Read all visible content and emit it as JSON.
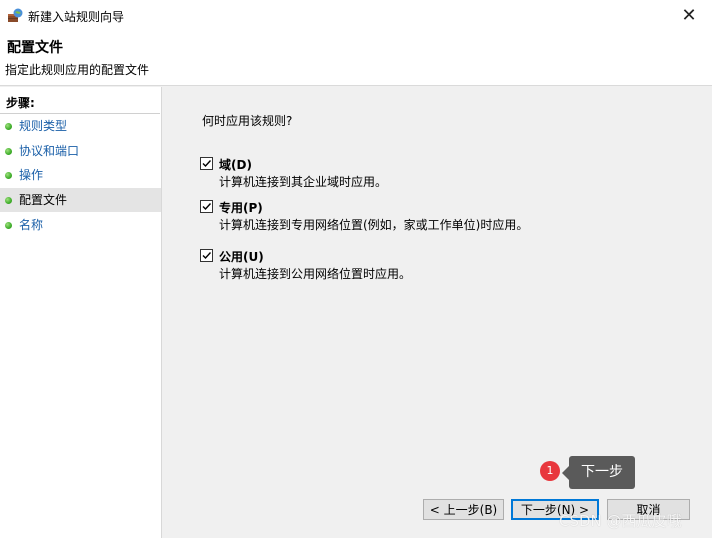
{
  "window": {
    "title": "新建入站规则向导",
    "close_glyph": "✕"
  },
  "header": {
    "title": "配置文件",
    "subtitle": "指定此规则应用的配置文件"
  },
  "sidebar": {
    "heading": "步骤:",
    "items": [
      {
        "label": "规则类型",
        "active": false
      },
      {
        "label": "协议和端口",
        "active": false
      },
      {
        "label": "操作",
        "active": false
      },
      {
        "label": "配置文件",
        "active": true
      },
      {
        "label": "名称",
        "active": false
      }
    ]
  },
  "main": {
    "question": "何时应用该规则?",
    "options": [
      {
        "label": "域(D)",
        "description": "计算机连接到其企业域时应用。",
        "checked": true
      },
      {
        "label": "专用(P)",
        "description": "计算机连接到专用网络位置(例如，家或工作单位)时应用。",
        "checked": true
      },
      {
        "label": "公用(U)",
        "description": "计算机连接到公用网络位置时应用。",
        "checked": true
      }
    ]
  },
  "annotation": {
    "badge_number": "1",
    "tooltip_text": "下一步"
  },
  "buttons": {
    "back_label": "< 上一步(B)",
    "next_label": "下一步(N) >",
    "cancel_label": "取消"
  },
  "watermark": "CSDN @西瓜皮哦",
  "colors": {
    "step_link": "#1a5fa8",
    "active_step_bg": "#e4e4e4",
    "badge": "#e8373d",
    "tooltip_bg": "#5a5a5a",
    "primary_border": "#0078d7"
  }
}
